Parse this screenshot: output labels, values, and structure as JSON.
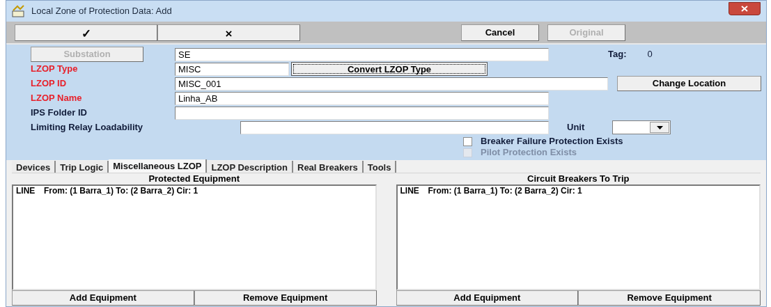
{
  "window": {
    "title": "Local Zone of Protection Data: Add"
  },
  "toolbar": {
    "buttons": [
      {
        "label": "✓",
        "disabled": false
      },
      {
        "label": "×",
        "disabled": false
      }
    ],
    "right_buttons": [
      {
        "label": "Cancel",
        "disabled": false
      },
      {
        "label": "Original",
        "disabled": true
      }
    ]
  },
  "form": {
    "substation": {
      "label": "Substation",
      "disabled": true,
      "value": "SE"
    },
    "tag": {
      "label": "Tag:",
      "value": "0"
    },
    "lzop_type": {
      "label": "LZOP Type",
      "required": true,
      "value": "MISC",
      "button": "Convert LZOP Type"
    },
    "lzop_id": {
      "label": "LZOP ID",
      "required": true,
      "value": "MISC_001",
      "button": "Change Location"
    },
    "lzop_name": {
      "label": "LZOP Name",
      "required": true,
      "value": "Linha_AB"
    },
    "ips_folder_id": {
      "label": "IPS Folder ID",
      "required": false
    },
    "limiting_relay_loadability": {
      "label": "Limiting Relay Loadability",
      "required": false
    },
    "unit": {
      "label": "Unit"
    },
    "checkboxes": [
      {
        "label": "Breaker Failure Protection Exists",
        "checked": false,
        "disabled": false
      },
      {
        "label": "Pilot Protection Exists",
        "checked": false,
        "disabled": true
      }
    ]
  },
  "tabs": [
    {
      "label": "Devices",
      "selected": false
    },
    {
      "label": "Trip Logic",
      "selected": false
    },
    {
      "label": "Miscellaneous LZOP",
      "selected": true
    },
    {
      "label": "LZOP Description",
      "selected": false
    },
    {
      "label": "Real Breakers",
      "selected": false
    },
    {
      "label": "Tools",
      "selected": false
    }
  ],
  "panels": [
    {
      "title": "Protected Equipment",
      "items": [
        {
          "type": "LINE",
          "description": "From: (1 Barra_1) To: (2 Barra_2) Cir: 1"
        }
      ],
      "buttons": [
        "Add Equipment",
        "Remove Equipment"
      ]
    },
    {
      "title": "Circuit Breakers To Trip",
      "items": [
        {
          "type": "LINE",
          "description": "From: (1 Barra_1) To: (2 Barra_2) Cir: 1"
        }
      ],
      "buttons": [
        "Add Equipment",
        "Remove Equipment"
      ]
    }
  ]
}
